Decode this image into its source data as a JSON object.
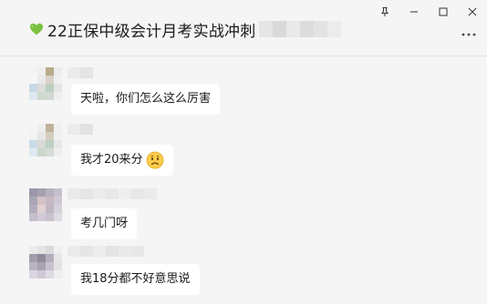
{
  "window": {
    "title": "22正保中级会计月考实战冲刺"
  },
  "controls": {
    "pin_icon": "pin-icon",
    "minimize_icon": "minimize-icon",
    "maximize_icon": "maximize-icon",
    "close_icon": "close-icon",
    "more_icon": "more-icon"
  },
  "messages": [
    {
      "text": "天啦，你们怎么这么厉害",
      "emoji": ""
    },
    {
      "text": "我才20来分",
      "emoji": "sad-face-icon"
    },
    {
      "text": "考几门呀",
      "emoji": ""
    },
    {
      "text": "我18分都不好意思说",
      "emoji": ""
    }
  ]
}
